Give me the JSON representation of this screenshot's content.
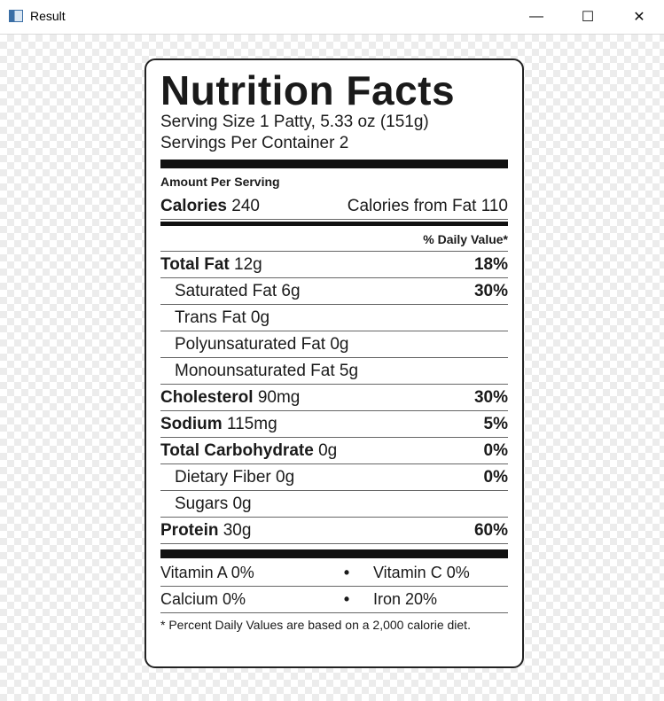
{
  "window": {
    "title": "Result",
    "minimize": "—",
    "maximize": "☐",
    "close": "✕"
  },
  "label": {
    "title": "Nutrition Facts",
    "serving_size": "Serving Size 1 Patty, 5.33 oz (151g)",
    "servings_per_container": "Servings Per Container 2",
    "amount_per_serving": "Amount Per Serving",
    "calories_label": "Calories",
    "calories_value": "240",
    "calories_from_fat": "Calories from Fat 110",
    "daily_value_header": "% Daily Value*",
    "rows": [
      {
        "name": "Total Fat",
        "amount": "12g",
        "dv": "18%",
        "bold": true,
        "indent": false
      },
      {
        "name": "Saturated Fat",
        "amount": "6g",
        "dv": "30%",
        "bold": false,
        "indent": true
      },
      {
        "name": "Trans Fat",
        "amount": "0g",
        "dv": "",
        "bold": false,
        "indent": true
      },
      {
        "name": "Polyunsaturated Fat",
        "amount": "0g",
        "dv": "",
        "bold": false,
        "indent": true
      },
      {
        "name": "Monounsaturated Fat",
        "amount": "5g",
        "dv": "",
        "bold": false,
        "indent": true
      },
      {
        "name": "Cholesterol",
        "amount": "90mg",
        "dv": "30%",
        "bold": true,
        "indent": false
      },
      {
        "name": "Sodium",
        "amount": "115mg",
        "dv": "5%",
        "bold": true,
        "indent": false
      },
      {
        "name": "Total Carbohydrate",
        "amount": "0g",
        "dv": "0%",
        "bold": true,
        "indent": false
      },
      {
        "name": "Dietary Fiber",
        "amount": "0g",
        "dv": "0%",
        "bold": false,
        "indent": true
      },
      {
        "name": "Sugars",
        "amount": "0g",
        "dv": "",
        "bold": false,
        "indent": true
      },
      {
        "name": "Protein",
        "amount": "30g",
        "dv": "60%",
        "bold": true,
        "indent": false
      }
    ],
    "vitamins": [
      {
        "left": "Vitamin A  0%",
        "dot": "•",
        "right": "Vitamin C  0%"
      },
      {
        "left": "Calcium  0%",
        "dot": "•",
        "right": "Iron  20%"
      }
    ],
    "footnote": "* Percent Daily Values are based on a 2,000 calorie diet."
  }
}
